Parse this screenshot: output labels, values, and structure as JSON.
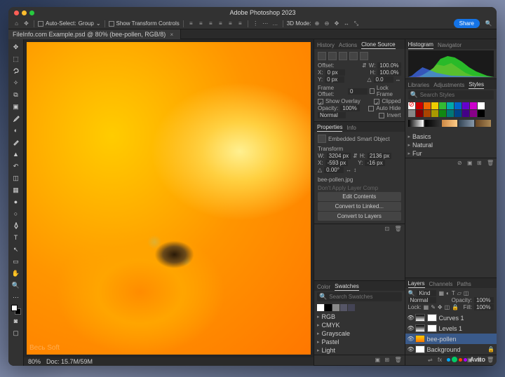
{
  "app": {
    "title": "Adobe Photoshop 2023",
    "share_label": "Share"
  },
  "options": {
    "auto_select_label": "Auto-Select:",
    "auto_select_mode": "Group",
    "show_transform_label": "Show Transform Controls",
    "menu_3d": "3D Mode:"
  },
  "tab": {
    "name": "FileInfo.com Example.psd @ 80% (bee-pollen, RGB/8)"
  },
  "status": {
    "zoom": "80%",
    "info": "Doc: 15.7M/59M"
  },
  "panels": {
    "history_tabs": [
      "History",
      "Actions",
      "Clone Source"
    ],
    "clone": {
      "offset_label": "Offset:",
      "x_label": "X:",
      "x_val": "0 px",
      "y_label": "Y:",
      "y_val": "0 px",
      "w_label": "W:",
      "w_val": "100.0%",
      "h_label": "H:",
      "h_val": "100.0%",
      "angle_val": "0.0",
      "frame_label": "Frame Offset:",
      "frame_val": "0",
      "lock_frame": "Lock Frame",
      "show_overlay": "Show Overlay",
      "clipped": "Clipped",
      "opacity_label": "Opacity:",
      "opacity_val": "100%",
      "auto_hide": "Auto Hide",
      "blend": "Normal",
      "invert": "Invert"
    },
    "properties_tabs": [
      "Properties",
      "Info"
    ],
    "properties": {
      "type": "Embedded Smart Object",
      "section": "Transform",
      "w_label": "W:",
      "w_val": "3204 px",
      "h_label": "H:",
      "h_val": "2136 px",
      "x_label": "X:",
      "x_val": "-593 px",
      "y_label": "Y:",
      "y_val": "-16 px",
      "angle": "0.00°",
      "filename": "bee-pollen.jpg",
      "comp_hint": "Don't Apply Layer Comp",
      "btn_edit": "Edit Contents",
      "btn_linked": "Convert to Linked...",
      "btn_layers": "Convert to Layers"
    },
    "color_tabs": [
      "Color",
      "Swatches"
    ],
    "swatches": {
      "search_placeholder": "Search Swatches",
      "folders": [
        "RGB",
        "CMYK",
        "Grayscale",
        "Pastel",
        "Light"
      ]
    },
    "histo_tabs": [
      "Histogram",
      "Navigator"
    ],
    "styles_tabs": [
      "Libraries",
      "Adjustments",
      "Styles"
    ],
    "styles": {
      "search_placeholder": "Search Styles",
      "folders": [
        "Basics",
        "Natural",
        "Fur"
      ]
    },
    "layers_tabs": [
      "Layers",
      "Channels",
      "Paths"
    ],
    "layers": {
      "kind": "Kind",
      "blend": "Normal",
      "opacity_label": "Opacity:",
      "opacity_val": "100%",
      "lock_label": "Lock:",
      "fill_label": "Fill:",
      "fill_val": "100%",
      "items": [
        {
          "name": "Curves 1"
        },
        {
          "name": "Levels 1"
        },
        {
          "name": "bee-pollen"
        },
        {
          "name": "Background"
        }
      ]
    }
  },
  "watermark": "Весь Soft",
  "external_logo": "Avito"
}
